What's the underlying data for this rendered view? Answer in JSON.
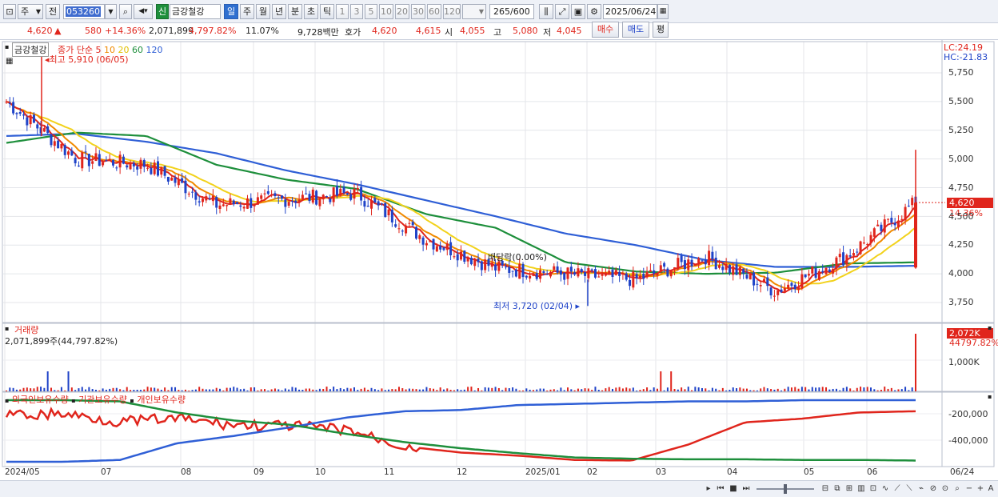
{
  "toolbar": {
    "mode_label": "주",
    "prev_label": "전",
    "code_value": "053260",
    "flag_label": "신",
    "stock_name": "금강철강",
    "period_tabs": [
      "일",
      "주",
      "월",
      "년",
      "분",
      "초",
      "틱"
    ],
    "number_tabs": [
      "1",
      "3",
      "5",
      "10",
      "20",
      "30",
      "60",
      "120"
    ],
    "count_value": "265",
    "count_total": "/600",
    "date_value": "2025/06/24"
  },
  "infobar": {
    "price": "4,620",
    "change_arrow": "▲",
    "change": "580",
    "change_pct": "+14.36%",
    "volume": "2,071,899",
    "volume_pct": "4,797.82%",
    "turnover": "11.07%",
    "amount": "9,728백만",
    "bid_label": "호가",
    "bid_price": "4,620",
    "ask_price": "4,615",
    "open_label": "시",
    "open_price": "4,055",
    "high_label": "고",
    "high_price": "5,080",
    "low_label": "저",
    "low_price": "4,045",
    "buy_label": "매수",
    "sell_label": "매도",
    "eval_label": "평"
  },
  "main_panel": {
    "stock_tag": "금강철강",
    "ma_label": "종가 단순",
    "ma_periods": [
      "5",
      "10",
      "20",
      "60",
      "120"
    ],
    "ma_colors": [
      "#e0251c",
      "#f08a00",
      "#f2d21c",
      "#1e8f3c",
      "#2f5fd6"
    ],
    "high_note": "최고 5,910 (06/05)",
    "low_note": "최저 3,720 (02/04)",
    "dividend_note": "배당락(0.00%)",
    "lc_label": "LC:24.19",
    "hc_label": "HC:-21.83",
    "current_price_tag": "4,620",
    "current_pct_tag": "14.36%"
  },
  "volume_panel": {
    "title": "거래량",
    "value_text": "2,071,899주(44,797.82%)",
    "current_tag": "2,072K",
    "current_pct_tag": "44797.82%"
  },
  "holdings_panel": {
    "series_labels": [
      "외국인보유수량",
      "기관보유수량",
      "개인보유수량"
    ],
    "series_colors": [
      "#e0251c",
      "#2f5fd6",
      "#1e8f3c"
    ]
  },
  "x_axis_labels": [
    "2024/05",
    "07",
    "08",
    "09",
    "10",
    "11",
    "12",
    "2025/01",
    "02",
    "03",
    "04",
    "05",
    "06",
    "06/24"
  ],
  "chart_data": {
    "type": "candlestick",
    "price_axis_ticks": [
      5750,
      5500,
      5250,
      5000,
      4750,
      4500,
      4250,
      4000,
      3750
    ],
    "price_axis_labels": [
      "5,750",
      "5,500",
      "5,250",
      "5,000",
      "4,750",
      "4,500",
      "4,250",
      "4,000",
      "3,750"
    ],
    "volume_axis_labels": [
      "1,000K"
    ],
    "holdings_axis_labels": [
      "-200,000",
      "-400,000"
    ],
    "close_path_months": [
      "2024/05",
      "07",
      "08",
      "09",
      "10",
      "11",
      "12",
      "2025/01",
      "02",
      "03",
      "04",
      "05",
      "06",
      "06/24"
    ],
    "close_approx": [
      5500,
      5000,
      4950,
      4600,
      4650,
      4700,
      4300,
      4050,
      4000,
      3950,
      4150,
      3850,
      4150,
      4620
    ],
    "ma120_approx": [
      5200,
      5220,
      5150,
      5050,
      4900,
      4780,
      4640,
      4500,
      4350,
      4250,
      4120,
      4060,
      4060,
      4070
    ],
    "ma60_approx": [
      5140,
      5230,
      5200,
      4950,
      4820,
      4740,
      4520,
      4400,
      4100,
      4020,
      4000,
      4010,
      4090,
      4100
    ],
    "volume_spike_last": 2071899,
    "high_point": {
      "date": "06/05",
      "price": 5910
    },
    "low_point": {
      "date": "02/04",
      "price": 3720
    },
    "last_price": 4620
  }
}
